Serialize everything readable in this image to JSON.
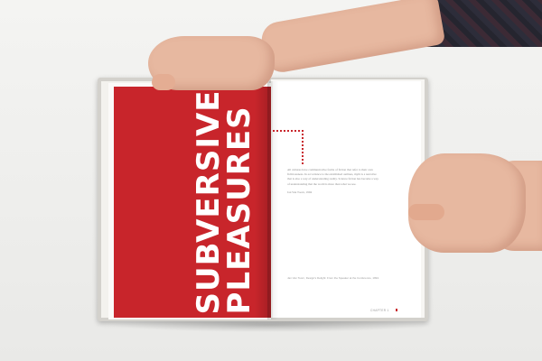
{
  "headline": {
    "line1": "SUBVERSIVE",
    "line2": "PLEASURES"
  },
  "colors": {
    "accent_red": "#c8252b",
    "background": "#f1f1ef",
    "skin": "#e7b8a0"
  },
  "right_page": {
    "body_paragraphs": [
      "All cultures have communicative forms of fiction that refer to their own fictitiousness. In accordance to the established outlines, myth is a narrative that is also a way of understanding reality. Science fiction has become a way of understanding that the world is more than what we see.",
      "Jan Van Toorn, 1994"
    ],
    "footnote": "Jan Van Toorn, Design's Delight: From the Speaker at the Conference, 1994.",
    "folio": "CHAPTER 1"
  }
}
